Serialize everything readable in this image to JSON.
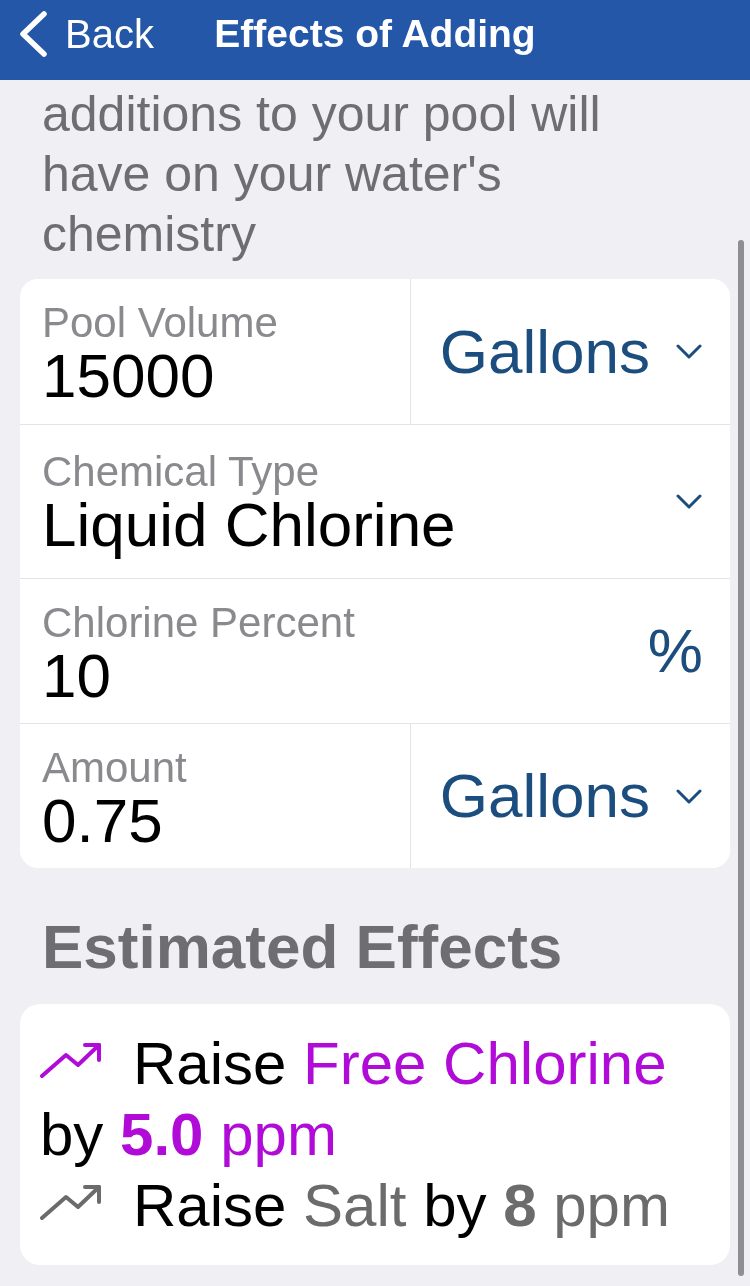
{
  "nav": {
    "back": "Back",
    "title": "Effects of Adding"
  },
  "intro": "additions to your pool will have on your water's chemistry",
  "form": {
    "fields": [
      {
        "kind": "input_select",
        "label": "Pool Volume",
        "value": "15000",
        "unit": "Gallons"
      },
      {
        "kind": "select",
        "label": "Chemical Type",
        "value": "Liquid Chlorine"
      },
      {
        "kind": "input_suffix",
        "label": "Chlorine Percent",
        "value": "10",
        "suffix": "%"
      },
      {
        "kind": "input_select",
        "label": "Amount",
        "value": "0.75",
        "unit": "Gallons"
      }
    ]
  },
  "effects": {
    "title": "Estimated Effects",
    "items": [
      {
        "verb": "Raise",
        "target": "Free Chlorine",
        "connector": "by",
        "amount": "5.0",
        "unit": "ppm",
        "color": "#b10bd8"
      },
      {
        "verb": "Raise",
        "target": "Salt",
        "connector": "by",
        "amount": "8",
        "unit": "ppm",
        "color": "#6b6b6b"
      }
    ]
  }
}
